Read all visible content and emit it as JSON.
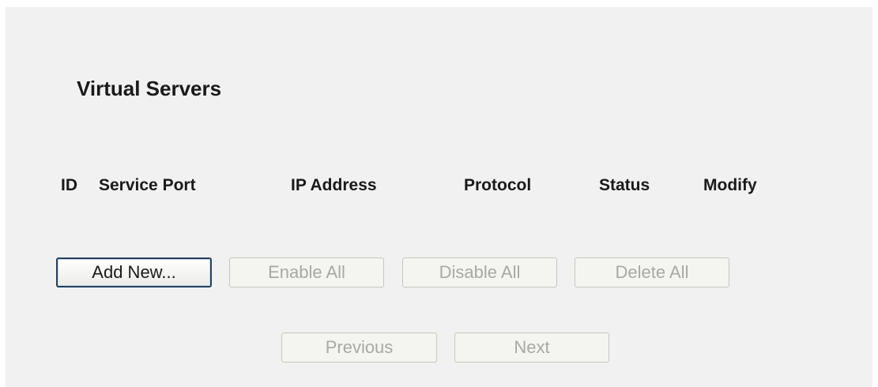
{
  "page": {
    "title": "Virtual Servers"
  },
  "table": {
    "columns": [
      "ID",
      "Service Port",
      "IP Address",
      "Protocol",
      "Status",
      "Modify"
    ],
    "rows": []
  },
  "actions": {
    "add_new": "Add New...",
    "enable_all": "Enable All",
    "disable_all": "Disable All",
    "delete_all": "Delete All"
  },
  "pagination": {
    "previous": "Previous",
    "next": "Next"
  }
}
